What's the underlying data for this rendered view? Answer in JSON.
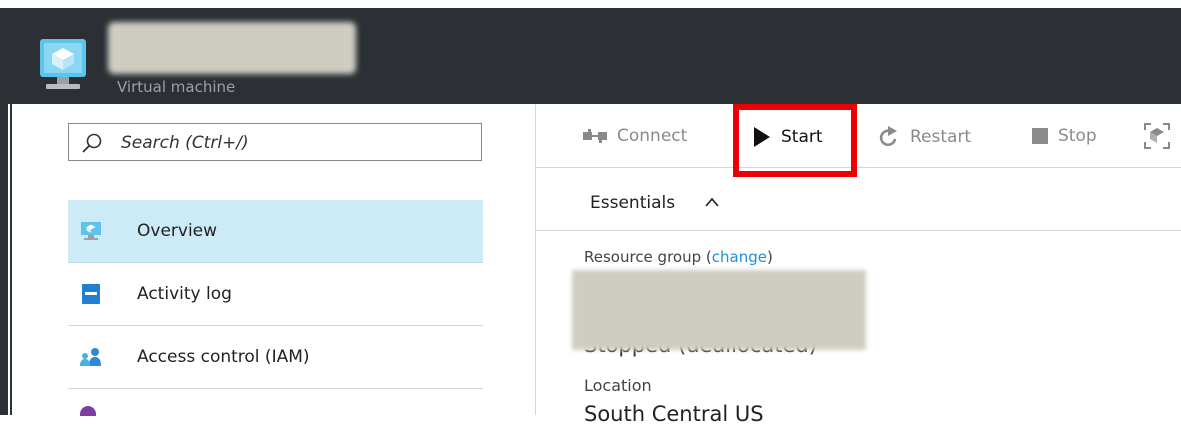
{
  "header": {
    "subtitle": "Virtual machine"
  },
  "search": {
    "placeholder": "Search (Ctrl+/)"
  },
  "nav": {
    "items": [
      {
        "label": "Overview",
        "icon": "vm-monitor-icon",
        "active": true
      },
      {
        "label": "Activity log",
        "icon": "activity-log-icon",
        "active": false
      },
      {
        "label": "Access control (IAM)",
        "icon": "users-icon",
        "active": false
      }
    ]
  },
  "commands": {
    "connect": "Connect",
    "start": "Start",
    "restart": "Restart",
    "stop": "Stop"
  },
  "essentials": {
    "title": "Essentials"
  },
  "fields": {
    "resource_group_label": "Resource group",
    "change_link": "change",
    "status_value": "Stopped (deallocated)",
    "location_label": "Location",
    "location_value": "South Central US"
  },
  "colors": {
    "header_bg": "#2c3035",
    "active_nav": "#cdeaf7",
    "highlight": "#ee0000",
    "link": "#1e90d6"
  }
}
